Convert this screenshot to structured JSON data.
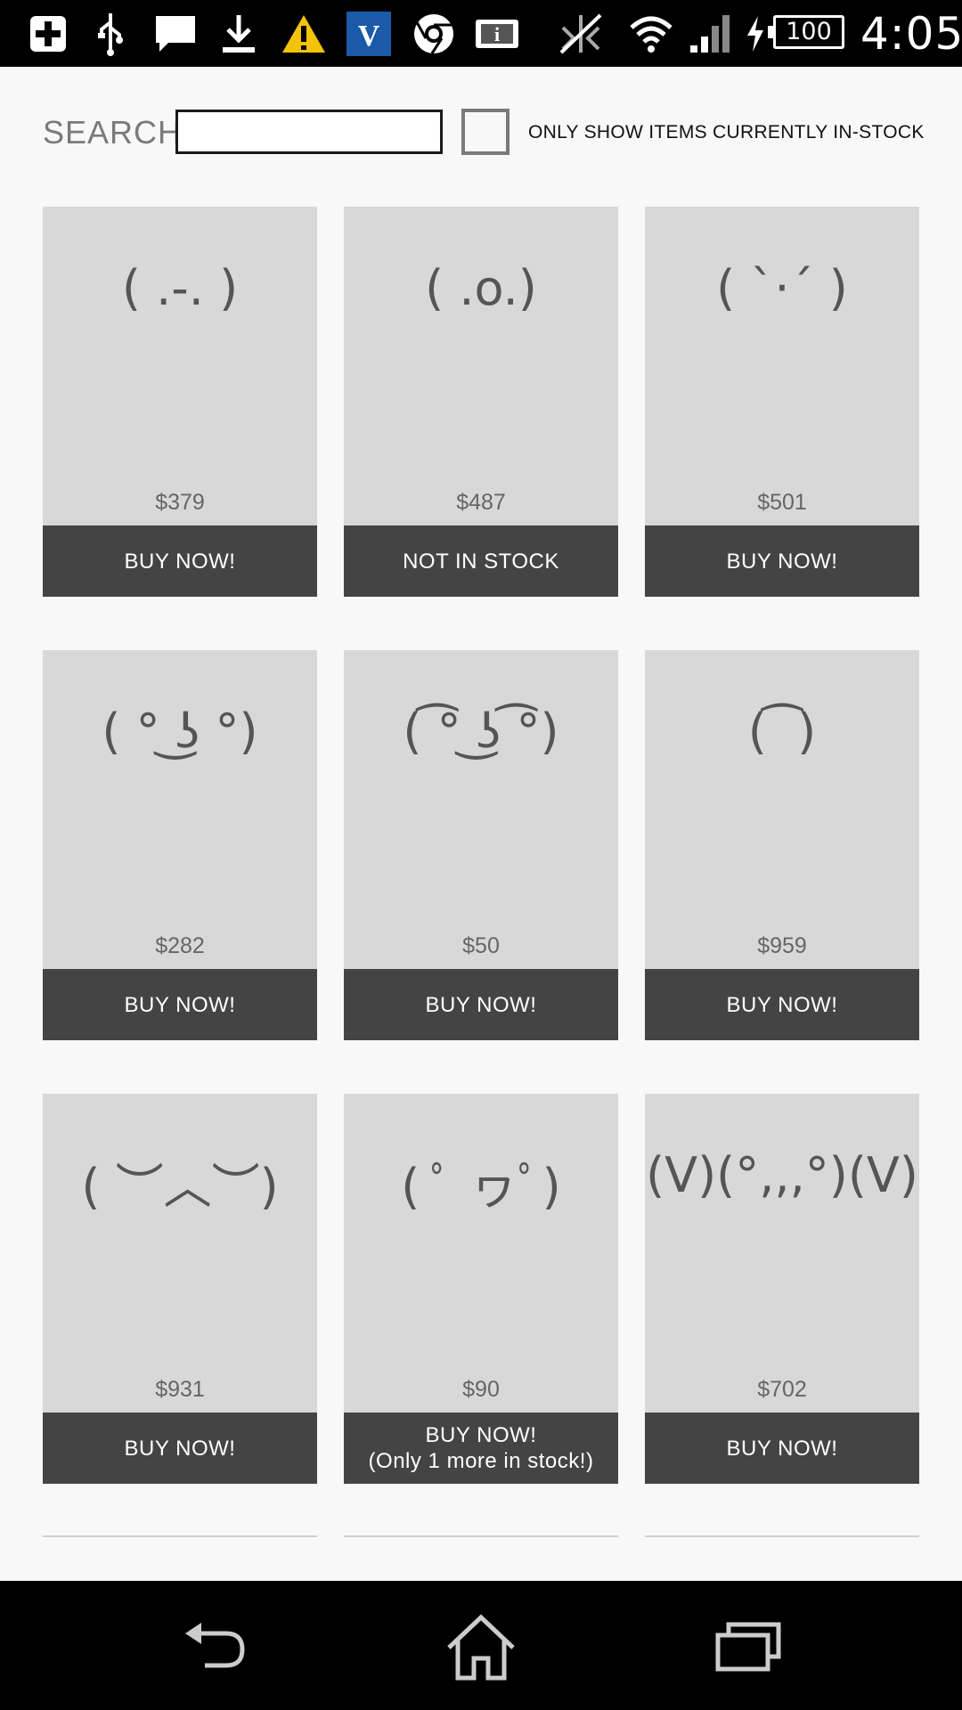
{
  "status_bar": {
    "icons": [
      "plus-icon",
      "usb-icon",
      "message-icon",
      "download-icon",
      "warning-icon",
      "v-app-icon",
      "chrome-icon",
      "info-icon",
      "no-signal-icon",
      "wifi-icon",
      "signal-icon",
      "charging-icon"
    ],
    "battery": "100",
    "time": "4:05"
  },
  "search": {
    "label": "SEARCH",
    "value": "",
    "stock_filter_label": "ONLY SHOW ITEMS CURRENTLY IN-STOCK",
    "stock_filter_checked": false
  },
  "products": [
    {
      "face": "( .-. )",
      "price": "$379",
      "button": "BUY NOW!",
      "button_note": ""
    },
    {
      "face": "( .o.)",
      "price": "$487",
      "button": "NOT IN STOCK",
      "button_note": ""
    },
    {
      "face": "( `·´ )",
      "price": "$501",
      "button": "BUY NOW!",
      "button_note": ""
    },
    {
      "face": "( ° ͜ʖ °)",
      "price": "$282",
      "button": "BUY NOW!",
      "button_note": ""
    },
    {
      "face": "( ͡° ͜ʖ ͡°)",
      "price": "$50",
      "button": "BUY NOW!",
      "button_note": ""
    },
    {
      "face": "(   ͡   )",
      "price": "$959",
      "button": "BUY NOW!",
      "button_note": ""
    },
    {
      "face": "( ︶︿︶)",
      "price": "$931",
      "button": "BUY NOW!",
      "button_note": ""
    },
    {
      "face": "( ﾟ ヮﾟ)",
      "price": "$90",
      "button": "BUY NOW!",
      "button_note": "(Only 1 more in stock!)"
    },
    {
      "face": "(V)(°,,,°)(V)",
      "price": "$702",
      "button": "BUY NOW!",
      "button_note": ""
    }
  ],
  "nav_bar": {
    "icons": [
      "back-icon",
      "home-icon",
      "recent-apps-icon"
    ]
  },
  "colors": {
    "status_bar": "#000000",
    "background": "#f8f8f8",
    "card": "#d8d8d8",
    "button": "#444444",
    "warning": "#f3c30a",
    "v_app": "#1a5aa8"
  }
}
